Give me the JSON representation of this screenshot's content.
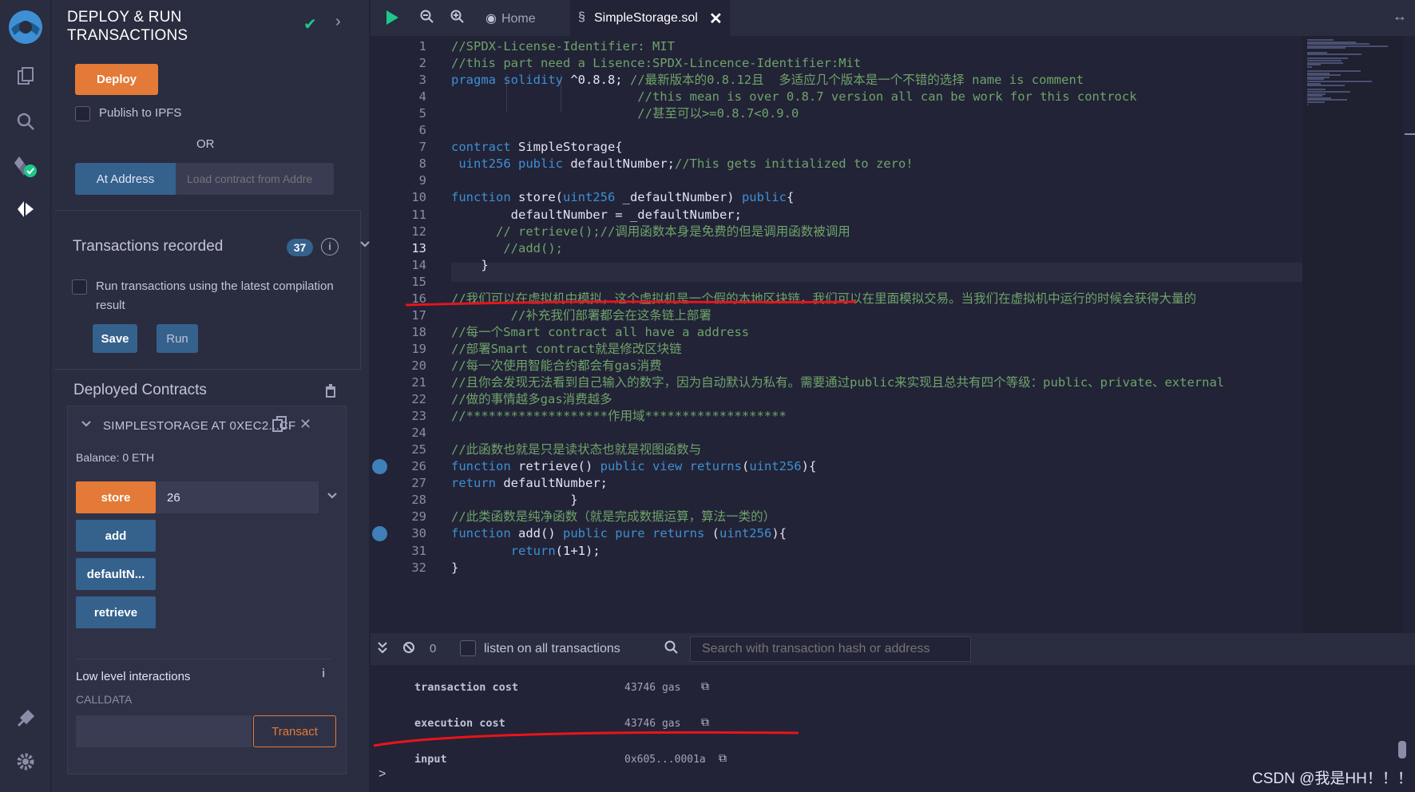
{
  "sidebar_icons": [
    "remix-logo",
    "file-explorer-icon",
    "search-icon",
    "solidity-compiler-icon",
    "deploy-run-icon",
    "plugin-manager-icon",
    "settings-icon"
  ],
  "panel": {
    "title": "DEPLOY & RUN TRANSACTIONS",
    "deploy_label": "Deploy",
    "publish_ipfs_label": "Publish to IPFS",
    "or_label": "OR",
    "at_address_label": "At Address",
    "load_contract_placeholder": "Load contract from Addre",
    "transactions_recorded_label": "Transactions recorded",
    "transactions_recorded_count": "37",
    "info_glyph": "i",
    "run_latest_label": "Run transactions using the latest compilation result",
    "save_label": "Save",
    "run_label": "Run",
    "deployed_contracts_label": "Deployed Contracts",
    "contract": {
      "name": "SIMPLESTORAGE AT 0XEC2...CF",
      "balance": "Balance: 0 ETH",
      "functions": [
        {
          "label": "store",
          "color": "#e47a37",
          "input_value": "26"
        },
        {
          "label": "add",
          "color": "#35618d"
        },
        {
          "label": "defaultN...",
          "color": "#35618d"
        },
        {
          "label": "retrieve",
          "color": "#35618d"
        }
      ],
      "low_level_label": "Low level interactions",
      "low_level_info_glyph": "i",
      "calldata_label": "CALLDATA",
      "transact_label": "Transact"
    }
  },
  "tabs": {
    "home_label": "Home",
    "active_label": "SimpleStorage.sol"
  },
  "editor": {
    "current_line": 13,
    "breakpoint_lines": [
      26,
      30
    ],
    "lines": [
      {
        "n": "1",
        "parts": [
          [
            "cm",
            "//SPDX-License-Identifier: MIT"
          ]
        ]
      },
      {
        "n": "2",
        "parts": [
          [
            "cm",
            "//this part need a Lisence:SPDX-Lincence-Identifier:Mit"
          ]
        ]
      },
      {
        "n": "3",
        "parts": [
          [
            "kw",
            "pragma solidity"
          ],
          [
            "tx",
            " ^0.8.8; "
          ],
          [
            "cm",
            "//最新版本的0.8.12且  多适应几个版本是一个不错的选择 name is comment"
          ]
        ]
      },
      {
        "n": "4",
        "parts": [
          [
            "tx",
            "                         "
          ],
          [
            "cm",
            "//this mean is over 0.8.7 version all can be work for this controck"
          ]
        ]
      },
      {
        "n": "5",
        "parts": [
          [
            "tx",
            "                         "
          ],
          [
            "cm",
            "//甚至可以>=0.8.7<0.9.0"
          ]
        ]
      },
      {
        "n": "6",
        "parts": [
          [
            "tx",
            ""
          ]
        ]
      },
      {
        "n": "7",
        "parts": [
          [
            "kw",
            "contract"
          ],
          [
            "tx",
            " SimpleStorage{"
          ]
        ]
      },
      {
        "n": "8",
        "parts": [
          [
            "tx",
            " "
          ],
          [
            "ty",
            "uint256"
          ],
          [
            "kw",
            " public"
          ],
          [
            "tx",
            " defaultNumber;"
          ],
          [
            "cm",
            "//This gets initialized to zero!"
          ]
        ]
      },
      {
        "n": "9",
        "parts": [
          [
            "tx",
            ""
          ]
        ]
      },
      {
        "n": "10",
        "parts": [
          [
            "kw",
            "function"
          ],
          [
            "tx",
            " store("
          ],
          [
            "ty",
            "uint256"
          ],
          [
            "tx",
            " _defaultNumber) "
          ],
          [
            "kw",
            "public"
          ],
          [
            "tx",
            "{"
          ]
        ]
      },
      {
        "n": "11",
        "parts": [
          [
            "tx",
            "        defaultNumber = _defaultNumber;"
          ]
        ]
      },
      {
        "n": "12",
        "parts": [
          [
            "tx",
            "      "
          ],
          [
            "cm",
            "// retrieve();//调用函数本身是免费的但是调用函数被调用"
          ]
        ]
      },
      {
        "n": "13",
        "parts": [
          [
            "tx",
            "       "
          ],
          [
            "cm",
            "//add();"
          ]
        ]
      },
      {
        "n": "14",
        "parts": [
          [
            "tx",
            "    }"
          ]
        ]
      },
      {
        "n": "15",
        "parts": [
          [
            "tx",
            ""
          ]
        ]
      },
      {
        "n": "16",
        "parts": [
          [
            "cm",
            "//我们可以在虚拟机中模拟，这个虚拟机是一个假的本地区块链，我们可以在里面模拟交易。当我们在虚拟机中运行的时候会获得大量的"
          ]
        ]
      },
      {
        "n": "17",
        "parts": [
          [
            "tx",
            "        "
          ],
          [
            "cm",
            "//补充我们部署都会在这条链上部署"
          ]
        ]
      },
      {
        "n": "18",
        "parts": [
          [
            "cm",
            "//每一个Smart contract all have a address"
          ]
        ]
      },
      {
        "n": "19",
        "parts": [
          [
            "cm",
            "//部署Smart contract就是修改区块链"
          ]
        ]
      },
      {
        "n": "20",
        "parts": [
          [
            "cm",
            "//每一次使用智能合约都会有gas消费"
          ]
        ]
      },
      {
        "n": "21",
        "parts": [
          [
            "cm",
            "//且你会发现无法看到自己输入的数字，因为自动默认为私有。需要通过public来实现且总共有四个等级：public、private、external"
          ]
        ]
      },
      {
        "n": "22",
        "parts": [
          [
            "cm",
            "//做的事情越多gas消费越多"
          ]
        ]
      },
      {
        "n": "23",
        "parts": [
          [
            "cm",
            "//*******************作用域*******************"
          ]
        ]
      },
      {
        "n": "24",
        "parts": [
          [
            "tx",
            ""
          ]
        ]
      },
      {
        "n": "25",
        "parts": [
          [
            "cm",
            "//此函数也就是只是读状态也就是视图函数与"
          ]
        ]
      },
      {
        "n": "26",
        "parts": [
          [
            "kw",
            "function"
          ],
          [
            "tx",
            " retrieve() "
          ],
          [
            "kw",
            "public view"
          ],
          [
            "tx",
            " "
          ],
          [
            "kw",
            "returns"
          ],
          [
            "tx",
            "("
          ],
          [
            "ty",
            "uint256"
          ],
          [
            "tx",
            "){"
          ]
        ]
      },
      {
        "n": "27",
        "parts": [
          [
            "kw",
            "return"
          ],
          [
            "tx",
            " defaultNumber;"
          ]
        ]
      },
      {
        "n": "28",
        "parts": [
          [
            "tx",
            "                }"
          ]
        ]
      },
      {
        "n": "29",
        "parts": [
          [
            "cm",
            "//此类函数是纯净函数（就是完成数据运算，算法一类的）"
          ]
        ]
      },
      {
        "n": "30",
        "parts": [
          [
            "kw",
            "function"
          ],
          [
            "tx",
            " add() "
          ],
          [
            "kw",
            "public pure"
          ],
          [
            "tx",
            " "
          ],
          [
            "kw",
            "returns"
          ],
          [
            "tx",
            " ("
          ],
          [
            "ty",
            "uint256"
          ],
          [
            "tx",
            "){"
          ]
        ]
      },
      {
        "n": "31",
        "parts": [
          [
            "tx",
            "        "
          ],
          [
            "kw",
            "return"
          ],
          [
            "tx",
            "(1+1);"
          ]
        ]
      },
      {
        "n": "32",
        "parts": [
          [
            "tx",
            "}"
          ]
        ]
      }
    ]
  },
  "terminal": {
    "count": "0",
    "listen_label": "listen on all transactions",
    "search_placeholder": "Search with transaction hash or address",
    "rows": [
      {
        "key": "transaction cost",
        "value": "43746 gas"
      },
      {
        "key": "execution cost",
        "value": "43746 gas"
      },
      {
        "key": "input",
        "value": "0x605...0001a"
      }
    ],
    "prompt": ">"
  },
  "watermark": "CSDN @我是HH！！！",
  "colors": {
    "background": "#222336",
    "panel": "#2a2c3f",
    "accent_orange": "#e47a37",
    "accent_blue": "#35618d",
    "keyword": "#3e8fd4",
    "comment": "#6ea36a",
    "annotation_red": "#e8141b"
  }
}
